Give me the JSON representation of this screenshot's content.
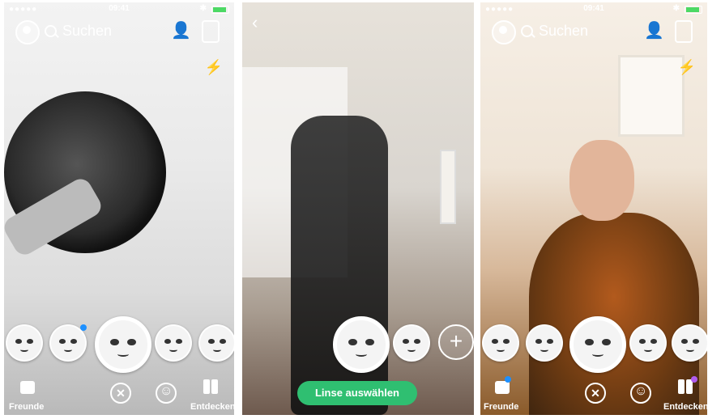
{
  "status": {
    "carrier": "●●●●● ",
    "time": "09:41",
    "bluetooth": "✱"
  },
  "search": {
    "label": "Suchen"
  },
  "screens": [
    {
      "friends_label": "Freunde",
      "discover_label": "Entdecken",
      "close_symbol": "✕"
    },
    {
      "select_lens_label": "Linse auswählen",
      "add_symbol": "+",
      "back_symbol": "‹"
    },
    {
      "friends_label": "Freunde",
      "discover_label": "Entdecken",
      "close_symbol": "✕"
    }
  ],
  "icons": {
    "add_friend": "add-friend-icon",
    "flash": "⚡",
    "camera_flip": "camera-flip-icon"
  },
  "colors": {
    "accent_green": "#2fbf71",
    "notify_blue": "#1e90ff",
    "notify_purple": "#b05cf0"
  }
}
